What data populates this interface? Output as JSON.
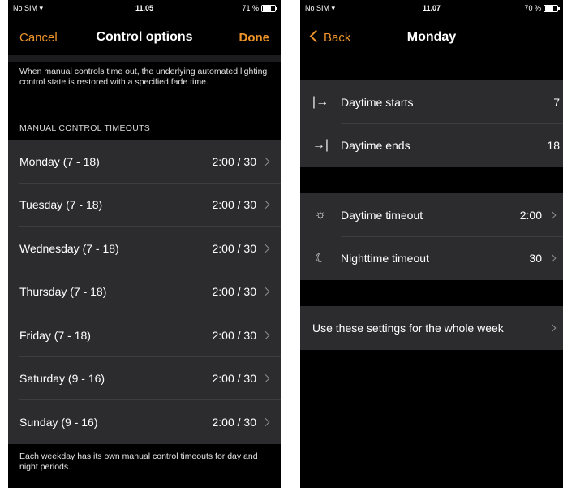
{
  "left": {
    "status": {
      "carrier": "No SIM",
      "time": "11.05",
      "battery": "71 %",
      "battery_level": 0.71
    },
    "nav": {
      "cancel": "Cancel",
      "title": "Control options",
      "done": "Done"
    },
    "intro": "When manual controls time out, the underlying automated lighting control state is restored with a specified fade time.",
    "section": "MANUAL CONTROL TIMEOUTS",
    "days": [
      {
        "label": "Monday (7 - 18)",
        "value": "2:00 / 30"
      },
      {
        "label": "Tuesday (7 - 18)",
        "value": "2:00 / 30"
      },
      {
        "label": "Wednesday (7 - 18)",
        "value": "2:00 / 30"
      },
      {
        "label": "Thursday (7 - 18)",
        "value": "2:00 / 30"
      },
      {
        "label": "Friday (7 - 18)",
        "value": "2:00 / 30"
      },
      {
        "label": "Saturday (9 - 16)",
        "value": "2:00 / 30"
      },
      {
        "label": "Sunday (9 - 16)",
        "value": "2:00 / 30"
      }
    ],
    "footer": "Each weekday has its own manual control timeouts for day and night periods."
  },
  "right": {
    "status": {
      "carrier": "No SIM",
      "time": "11.07",
      "battery": "70 %",
      "battery_level": 0.7
    },
    "nav": {
      "back": "Back",
      "title": "Monday"
    },
    "daytime": {
      "starts_label": "Daytime starts",
      "starts_value": "7",
      "ends_label": "Daytime ends",
      "ends_value": "18"
    },
    "timeouts": {
      "day_label": "Daytime timeout",
      "day_value": "2:00",
      "night_label": "Nighttime timeout",
      "night_value": "30"
    },
    "apply_week": "Use these settings for the whole week",
    "icons": {
      "starts": "daytime-start-icon",
      "ends": "daytime-end-icon",
      "sun": "sun-icon",
      "moon": "moon-icon"
    },
    "accent_color": "#f0952a"
  }
}
